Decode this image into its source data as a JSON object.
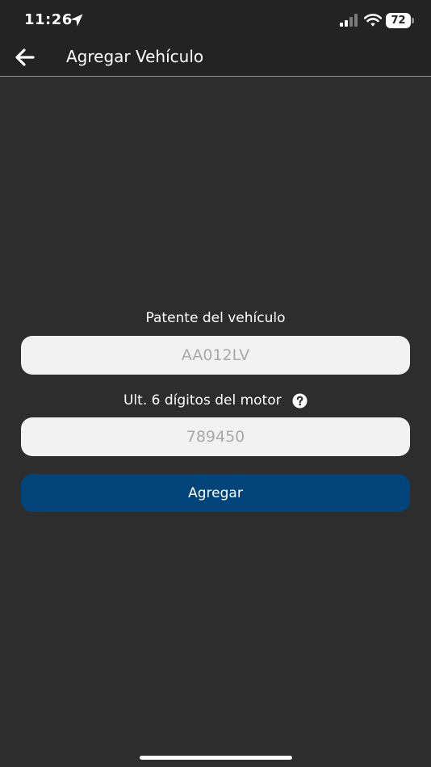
{
  "status_bar": {
    "time": "11:26",
    "battery_level": "72",
    "icons": [
      "location-arrow-icon",
      "cellular-signal-icon",
      "wifi-icon",
      "battery-icon"
    ]
  },
  "nav": {
    "back_icon": "arrow-left-icon",
    "title": "Agregar Vehículo"
  },
  "form": {
    "plate_label": "Patente del vehículo",
    "plate_placeholder": "AA012LV",
    "plate_value": "",
    "motor_label": "Ult. 6 dígitos del motor",
    "motor_help_icon": "question-circle-icon",
    "motor_placeholder": "789450",
    "motor_value": "",
    "submit_label": "Agregar"
  },
  "colors": {
    "background": "#2d2d2d",
    "header": "#232323",
    "input_background": "#f2f2f2",
    "placeholder": "#a9a9a9",
    "accent_button": "#00447a",
    "text": "#ffffff"
  }
}
